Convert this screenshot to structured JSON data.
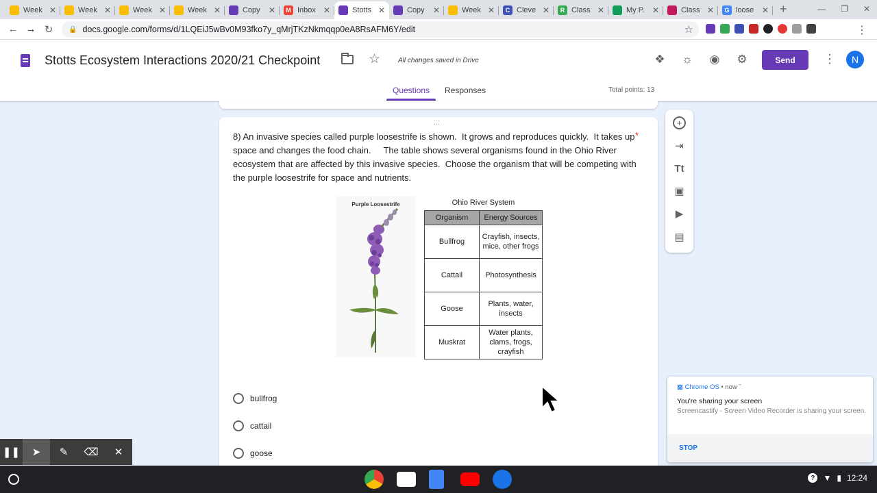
{
  "browser": {
    "tabs": [
      {
        "title": "Week",
        "color": "#fbbc04"
      },
      {
        "title": "Week",
        "color": "#fbbc04"
      },
      {
        "title": "Week",
        "color": "#fbbc04"
      },
      {
        "title": "Week",
        "color": "#fbbc04"
      },
      {
        "title": "Copy",
        "color": "#673ab7"
      },
      {
        "title": "Inbox",
        "color": "#ea4335"
      },
      {
        "title": "Stotts",
        "color": "#673ab7",
        "active": true
      },
      {
        "title": "Copy",
        "color": "#673ab7"
      },
      {
        "title": "Week",
        "color": "#fbbc04"
      },
      {
        "title": "Cleve",
        "color": "#3f51b5"
      },
      {
        "title": "Class",
        "color": "#34a853"
      },
      {
        "title": "My P.",
        "color": "#0f9d58"
      },
      {
        "title": "Class",
        "color": "#c2185b"
      },
      {
        "title": "loose",
        "color": "#4285f4"
      }
    ],
    "tab_favicon_letters": [
      "",
      "",
      "",
      "",
      "",
      "M",
      "",
      "",
      "",
      "C",
      "R",
      "",
      "",
      "G"
    ],
    "url": "docs.google.com/forms/d/1LQEiJ5wBv0M93fko7y_qMrjTKzNkmqqp0eA8RsAFM6Y/edit"
  },
  "form_header": {
    "title": "Stotts Ecosystem Interactions  2020/21 Checkpoint",
    "saved_status": "All changes saved in Drive",
    "send_label": "Send",
    "avatar_letter": "N",
    "tabs": {
      "questions": "Questions",
      "responses": "Responses"
    },
    "total_points": "Total points: 13",
    "accent_color": "#673ab7"
  },
  "question": {
    "text": "8) An invasive species called purple loosestrife is shown.  It grows and reproduces quickly.  It takes up space and changes the food chain.     The table shows several organisms found in the Ohio River ecosystem that are affected by this invasive species.  Choose the organism that will be competing with the purple loosestrife for space and nutrients.",
    "required_mark": "*",
    "image_label": "Purple Loosestrife",
    "table": {
      "title": "Ohio River System",
      "headers": [
        "Organism",
        "Energy Sources"
      ],
      "rows": [
        [
          "Bullfrog",
          "Crayfish, insects, mice, other frogs"
        ],
        [
          "Cattail",
          "Photosynthesis"
        ],
        [
          "Goose",
          "Plants, water, insects"
        ],
        [
          "Muskrat",
          "Water plants, clams, frogs, crayfish"
        ]
      ]
    },
    "options": [
      "bullfrog",
      "cattail",
      "goose"
    ]
  },
  "notification": {
    "source": "Chrome OS",
    "time": "now",
    "title": "You're sharing your screen",
    "body": "Screencastify - Screen Video Recorder is sharing your screen.",
    "action": "STOP"
  },
  "shelf": {
    "time": "12:24",
    "help_label": "?"
  }
}
